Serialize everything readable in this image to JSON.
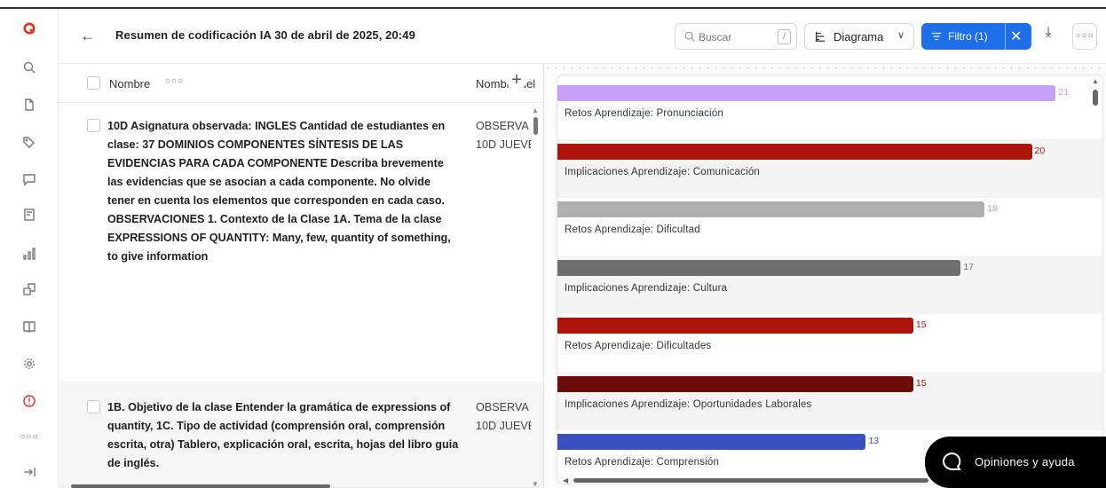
{
  "header": {
    "title": "Resumen de codificación IA 30 de abril de 2025, 20:49",
    "search_placeholder": "Buscar",
    "search_shortcut": "/",
    "view_label": "Diagrama",
    "filter_label": "Filtro (1)"
  },
  "rail": {
    "icons": [
      "logo-icon",
      "search-icon",
      "document-icon",
      "tag-icon",
      "comment-icon",
      "memo-icon",
      "chart-icon",
      "ai-icon",
      "book-icon",
      "settings-icon",
      "alert-icon",
      "more-icon",
      "collapse-icon"
    ]
  },
  "table": {
    "columns": [
      "Nombre",
      "Nombre del"
    ],
    "rows": [
      {
        "text": "10D Asignatura observada: INGLES Cantidad de estudiantes en clase: 37 DOMINIOS COMPONENTES SÍNTESIS DE LAS EVIDENCIAS PARA CADA COMPONENTE Describa brevemente las evidencias que se asocian a cada componente. No olvide tener en cuenta los elementos que corresponden en cada caso. OBSERVACIONES 1. Contexto de la Clase 1A. Tema de la clase EXPRESSIONS OF QUANTITY: Many, few, quantity of something, to give information",
        "col2_line1": "OBSERVA",
        "col2_line2": "10D JUEVE"
      },
      {
        "text": "1B. Objetivo de la clase Entender la gramática de expressions of quantity, 1C. Tipo de actividad (comprensión oral, comprensión escrita, otra) Tablero, explicación oral, escrita, hojas del libro guia de inglés.",
        "col2_line1": "OBSERVA",
        "col2_line2": "10D JUEVE"
      }
    ]
  },
  "chart_data": {
    "type": "bar",
    "orientation": "horizontal",
    "categories": [
      "Retos Aprendizaje: Pronunciación",
      "Implicaciones Aprendizaje: Comunicación",
      "Retos Aprendizaje: Dificultad",
      "Implicaciones Aprendizaje: Cultura",
      "Retos Aprendizaje: Dificultades",
      "Implicaciones Aprendizaje: Oportunidades Laborales",
      "Retos Aprendizaje: Comprensión"
    ],
    "values": [
      21,
      20,
      18,
      17,
      15,
      15,
      13
    ],
    "colors": [
      "#c5a0f5",
      "#aa1409",
      "#b0b0b0",
      "#6e6e6e",
      "#aa1409",
      "#6b0e0a",
      "#3a4fc0"
    ],
    "label_colors": [
      "#c5a0f5",
      "#aa1409",
      "#aaaaaa",
      "#6e6e6e",
      "#aa1409",
      "#aa1409",
      "#3a4fc0"
    ],
    "xlim": [
      0,
      21.7
    ]
  },
  "feedback": {
    "label": "Opiniones y ayuda"
  },
  "colors": {
    "accent": "#1e6fe8",
    "brand": "#e0301e"
  }
}
